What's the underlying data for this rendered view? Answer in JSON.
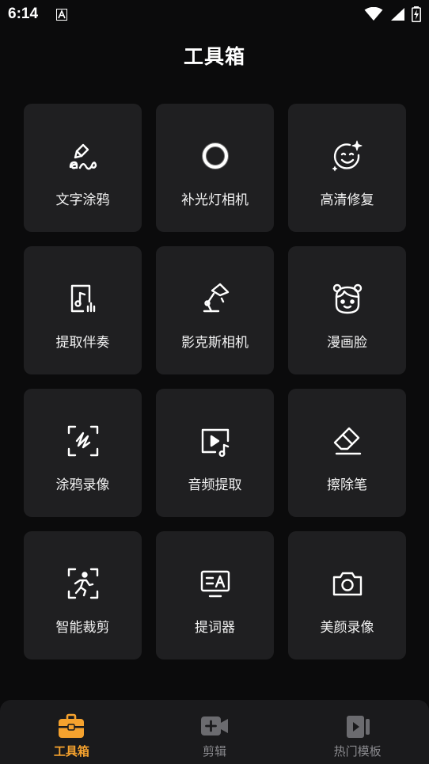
{
  "status_bar": {
    "time": "6:14"
  },
  "header": {
    "title": "工具箱"
  },
  "tools": [
    {
      "label": "文字涂鸦",
      "icon": "text-doodle-icon"
    },
    {
      "label": "补光灯相机",
      "icon": "ring-light-icon"
    },
    {
      "label": "高清修复",
      "icon": "face-sparkle-icon"
    },
    {
      "label": "提取伴奏",
      "icon": "music-extract-icon"
    },
    {
      "label": "影克斯相机",
      "icon": "desk-lamp-icon"
    },
    {
      "label": "漫画脸",
      "icon": "cartoon-face-icon"
    },
    {
      "label": "涂鸦录像",
      "icon": "doodle-record-icon"
    },
    {
      "label": "音频提取",
      "icon": "video-music-icon"
    },
    {
      "label": "擦除笔",
      "icon": "eraser-icon"
    },
    {
      "label": "智能裁剪",
      "icon": "smart-cut-icon"
    },
    {
      "label": "提词器",
      "icon": "teleprompter-icon"
    },
    {
      "label": "美颜录像",
      "icon": "camera-icon"
    }
  ],
  "bottom_nav": [
    {
      "label": "工具箱",
      "icon": "toolbox-icon",
      "active": true
    },
    {
      "label": "剪辑",
      "icon": "video-add-icon",
      "active": false
    },
    {
      "label": "热门模板",
      "icon": "template-icon",
      "active": false
    }
  ],
  "colors": {
    "accent": "#f5a22e",
    "tile_bg": "#1f1f21",
    "background": "#0b0b0c"
  }
}
